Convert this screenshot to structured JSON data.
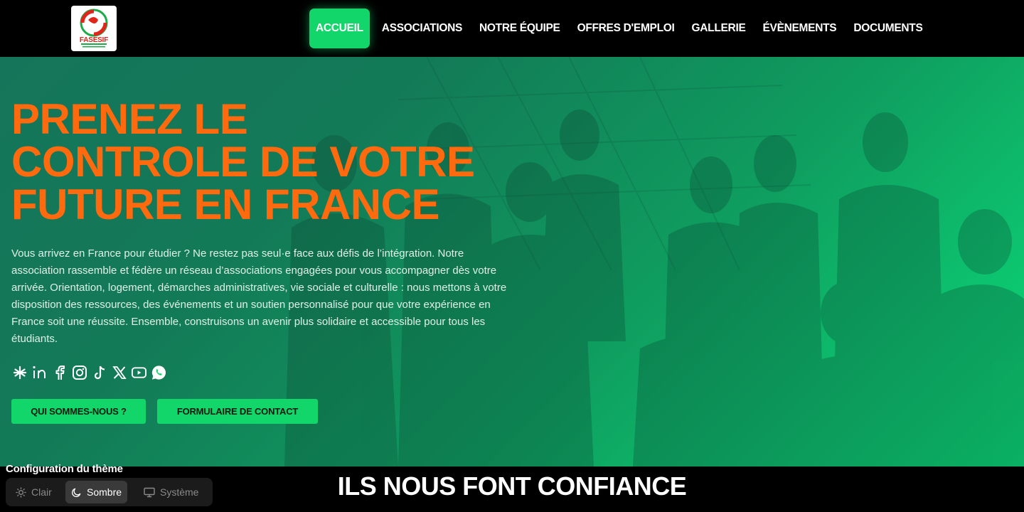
{
  "brand": {
    "logo_text": "FASESIF"
  },
  "nav": {
    "items": [
      {
        "label": "ACCUEIL",
        "active": true
      },
      {
        "label": "ASSOCIATIONS",
        "active": false
      },
      {
        "label": "NOTRE ÉQUIPE",
        "active": false
      },
      {
        "label": "OFFRES D'EMPLOI",
        "active": false
      },
      {
        "label": "GALLERIE",
        "active": false
      },
      {
        "label": "ÉVÈNEMENTS",
        "active": false
      },
      {
        "label": "DOCUMENTS",
        "active": false
      }
    ]
  },
  "hero": {
    "title_lines": [
      "PRENEZ LE",
      "CONTROLE DE VOTRE",
      "FUTURE EN FRANCE"
    ],
    "text": "Vous arrivez en France pour étudier ? Ne restez pas seul·e face aux défis de l’intégration. Notre association rassemble et fédère un réseau d’associations engagées pour vous accompagner dès votre arrivée. Orientation, logement, démarches administratives, vie sociale et culturelle : nous mettons à votre disposition des ressources, des événements et un soutien personnalisé pour que votre expérience en France soit une réussite. Ensemble, construisons un avenir plus solidaire et accessible pour tous les étudiants.",
    "socials": [
      "linktree-icon",
      "linkedin-icon",
      "facebook-icon",
      "instagram-icon",
      "tiktok-icon",
      "x-icon",
      "youtube-icon",
      "whatsapp-icon"
    ],
    "buttons": {
      "about": "QUI SOMMES-NOUS ?",
      "contact": "FORMULAIRE DE CONTACT"
    }
  },
  "trust": {
    "title": "ILS NOUS FONT CONFIANCE"
  },
  "theme": {
    "label": "Configuration du thème",
    "options": {
      "light": "Clair",
      "dark": "Sombre",
      "system": "Système"
    },
    "selected": "Sombre"
  },
  "colors": {
    "accent": "#12d66a",
    "title": "#ff6a0e",
    "background": "#000000"
  }
}
